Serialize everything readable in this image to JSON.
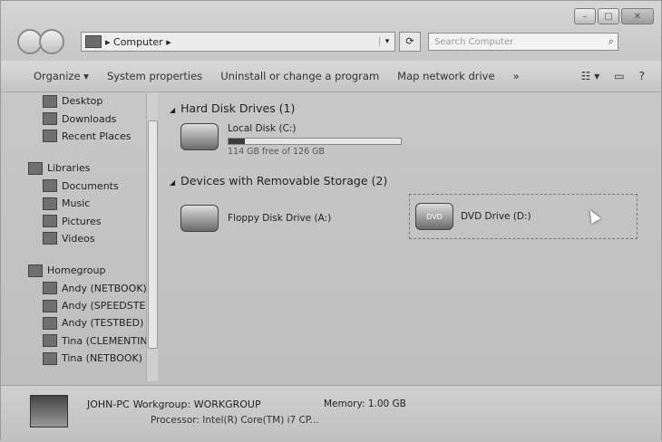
{
  "window": {
    "minimize": "–",
    "maximize": "□",
    "close": "✕"
  },
  "address": {
    "path": "▸ Computer ▸",
    "dropdown": "▾"
  },
  "search": {
    "placeholder": "Search Computer",
    "icon": "⌕"
  },
  "toolbar": {
    "items": [
      "Organize ▾",
      "System properties",
      "Uninstall or change a program",
      "Map network drive",
      "»"
    ],
    "icons": [
      "view-options-icon",
      "preview-pane-icon",
      "help-icon"
    ]
  },
  "sidebar": {
    "favorites": [
      {
        "label": "Desktop",
        "icon": "desktop-icon"
      },
      {
        "label": "Downloads",
        "icon": "downloads-icon"
      },
      {
        "label": "Recent Places",
        "icon": "recent-places-icon"
      }
    ],
    "libraries": {
      "label": "Libraries",
      "items": [
        "Documents",
        "Music",
        "Pictures",
        "Videos"
      ]
    },
    "homegroup": {
      "label": "Homegroup",
      "items": [
        "Andy (NETBOOK)",
        "Andy (SPEEDSTER",
        "Andy (TESTBED)",
        "Tina (CLEMENTINE",
        "Tina (NETBOOK)"
      ]
    }
  },
  "main": {
    "hdd_group": "Hard Disk Drives (1)",
    "local_disk": {
      "name": "Local Disk (C:)",
      "free": "114 GB free of 126 GB",
      "used_fraction": 0.095
    },
    "removable_group": "Devices with Removable Storage (2)",
    "floppy": "Floppy Disk Drive (A:)",
    "dvd": {
      "name": "DVD Drive (D:)",
      "badge": "DVD"
    }
  },
  "status": {
    "pc": "JOHN-PC",
    "workgroup": "Workgroup: WORKGROUP",
    "memory": "Memory: 1.00 GB",
    "processor": "Processor: Intel(R) Core(TM) i7 CP..."
  }
}
